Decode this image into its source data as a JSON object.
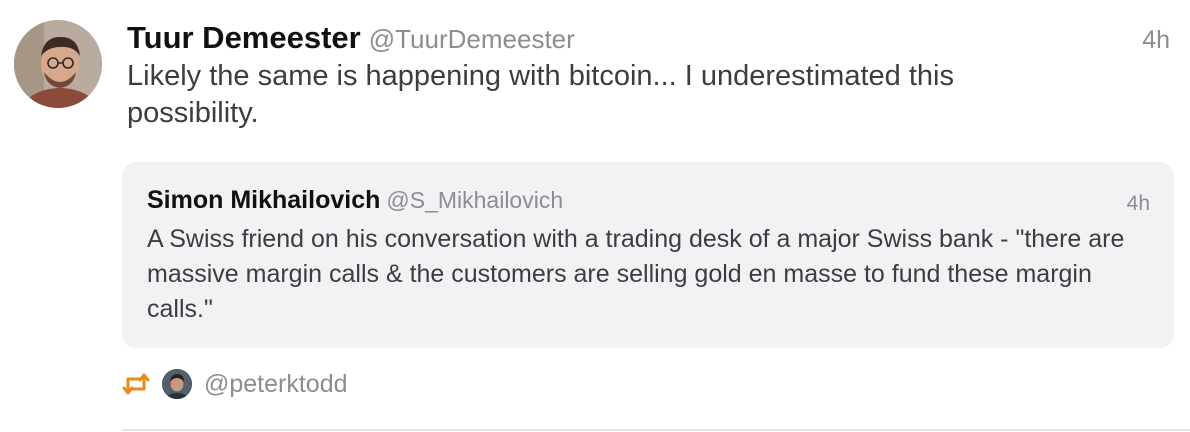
{
  "tweet": {
    "author": {
      "display_name": "Tuur Demeester",
      "handle": "@TuurDemeester",
      "avatar": "profile-photo"
    },
    "timestamp": "4h",
    "text": "Likely the same is happening with bitcoin... I underestimated this possibility.",
    "quoted": {
      "display_name": "Simon Mikhailovich",
      "handle": "@S_Mikhailovich",
      "timestamp": "4h",
      "text": "A Swiss friend on his conversation with a trading desk of a major Swiss bank - \"there are massive margin calls & the customers are selling gold en masse to fund these margin calls.\""
    },
    "retweeted_by": {
      "icon": "retweet-icon",
      "handle": "@peterktodd"
    }
  },
  "colors": {
    "retweet": "#e8891b",
    "muted_text": "#8a8d91",
    "quote_background": "#f2f2f4"
  }
}
